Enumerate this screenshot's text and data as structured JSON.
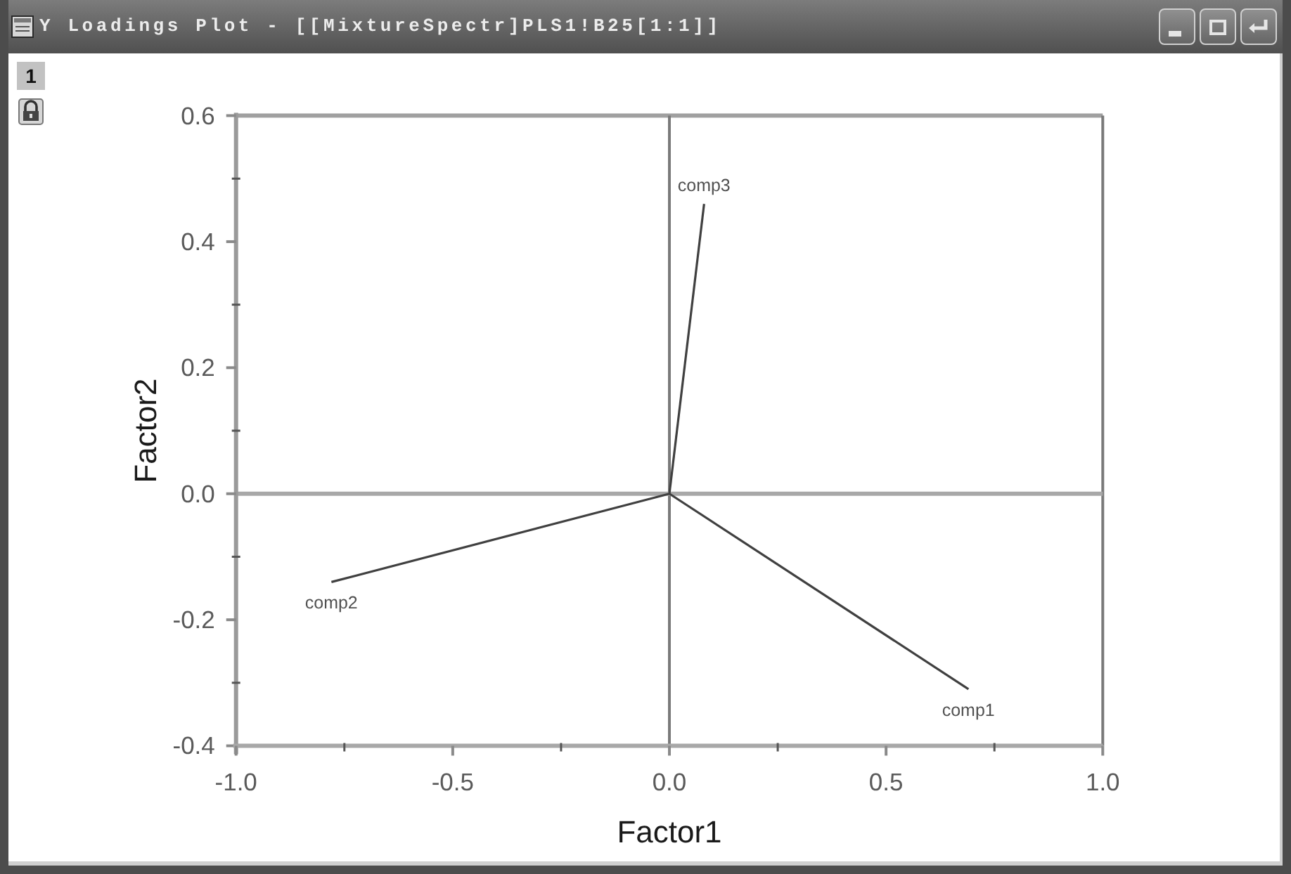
{
  "window": {
    "title": "Y Loadings Plot - [[MixtureSpectr]PLS1!B25[1:1]]"
  },
  "layers": [
    {
      "label": "1",
      "selected": true
    }
  ],
  "plot": {
    "chart_data": {
      "type": "line",
      "xlabel": "Factor1",
      "ylabel": "Factor2",
      "xlim": [
        -1,
        1
      ],
      "ylim": [
        -0.4,
        0.6
      ],
      "xticks": [
        {
          "value": -1,
          "label": "-1.0"
        },
        {
          "value": -0.5,
          "label": "-0.5"
        },
        {
          "value": 0,
          "label": "0.0"
        },
        {
          "value": 0.5,
          "label": "0.5"
        },
        {
          "value": 1,
          "label": "1.0"
        }
      ],
      "yticks": [
        {
          "value": 0.6,
          "label": "0.6"
        },
        {
          "value": 0.4,
          "label": "0.4"
        },
        {
          "value": 0.2,
          "label": "0.2"
        },
        {
          "value": 0,
          "label": "0.0"
        },
        {
          "value": -0.2,
          "label": "-0.2"
        },
        {
          "value": -0.4,
          "label": "-0.4"
        }
      ],
      "series": [
        {
          "name": "comp3",
          "color": "#404040",
          "x": [
            0,
            0.08
          ],
          "values": [
            0,
            0.46
          ]
        },
        {
          "name": "comp2",
          "color": "#404040",
          "x": [
            0,
            -0.78
          ],
          "values": [
            0,
            -0.14
          ]
        },
        {
          "name": "comp1",
          "color": "#404040",
          "x": [
            0,
            0.69
          ],
          "values": [
            0,
            -0.31
          ]
        }
      ]
    }
  }
}
